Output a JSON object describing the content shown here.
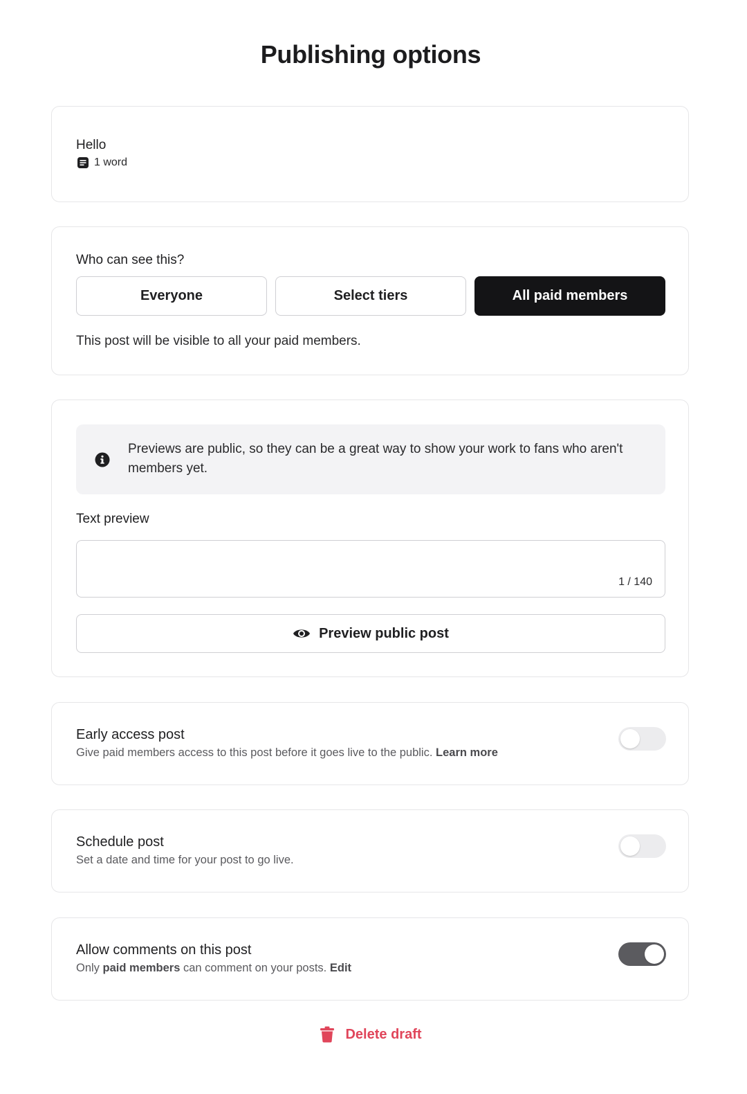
{
  "page": {
    "title": "Publishing options"
  },
  "post": {
    "title": "Hello",
    "word_count": "1 word",
    "word_count_icon": "document-icon"
  },
  "visibility": {
    "label": "Who can see this?",
    "options": [
      "Everyone",
      "Select tiers",
      "All paid members"
    ],
    "selected": "All paid members",
    "note": "This post will be visible to all your paid members."
  },
  "preview": {
    "info_icon": "info-icon",
    "info_text": "Previews are public, so they can be a great way to show your work to fans who aren't members yet.",
    "text_preview_label": "Text preview",
    "text_preview_value": "",
    "char_count": "1 / 140",
    "preview_button_label": "Preview public post",
    "preview_button_icon": "eye-icon"
  },
  "early_access": {
    "title": "Early access post",
    "description": "Give paid members access to this post before it goes live to the public.",
    "link": "Learn more",
    "enabled": false
  },
  "schedule": {
    "title": "Schedule post",
    "description": "Set a date and time for your post to go live.",
    "enabled": false
  },
  "comments": {
    "title": "Allow comments on this post",
    "desc_prefix": "Only",
    "desc_bold": "paid members",
    "desc_suffix": "can comment on your posts.",
    "link": "Edit",
    "enabled": true
  },
  "footer": {
    "delete_label": "Delete draft",
    "delete_icon": "trash-icon"
  },
  "colors": {
    "accent_dark": "#141416",
    "danger": "#e0455a",
    "toggle_on": "#5b5b5f",
    "toggle_off": "#ececee"
  }
}
